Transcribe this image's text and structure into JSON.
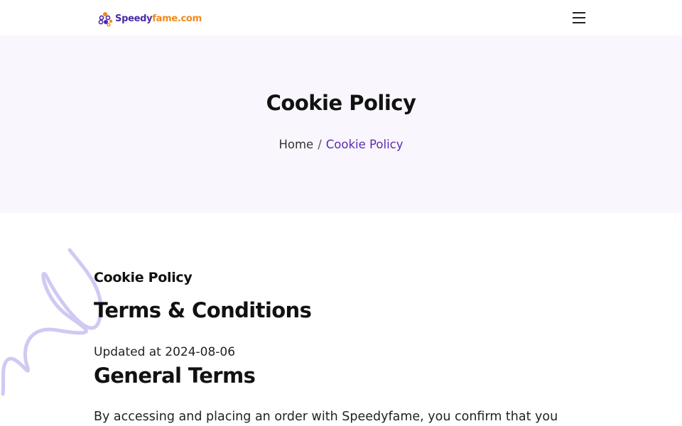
{
  "header": {
    "logo_text_part1": "Speedy",
    "logo_text_part2": "fame.com",
    "logo_alt": "Speedyfame.com",
    "menu_icon": "hamburger-menu-icon"
  },
  "hero": {
    "title": "Cookie Policy",
    "breadcrumb": {
      "home": "Home",
      "separator": "/",
      "current": "Cookie Policy"
    }
  },
  "content": {
    "kicker": "Cookie Policy",
    "title": "Terms & Conditions",
    "updated": "Updated at 2024-08-06",
    "section_title": "General Terms",
    "paragraph": "By accessing and placing an order with Speedyfame, you confirm that you"
  },
  "colors": {
    "brand_purple": "#5b2bb3",
    "brand_orange": "#f08a1c",
    "hero_background": "#f9f6fd",
    "squiggle": "#c9c4f2"
  }
}
